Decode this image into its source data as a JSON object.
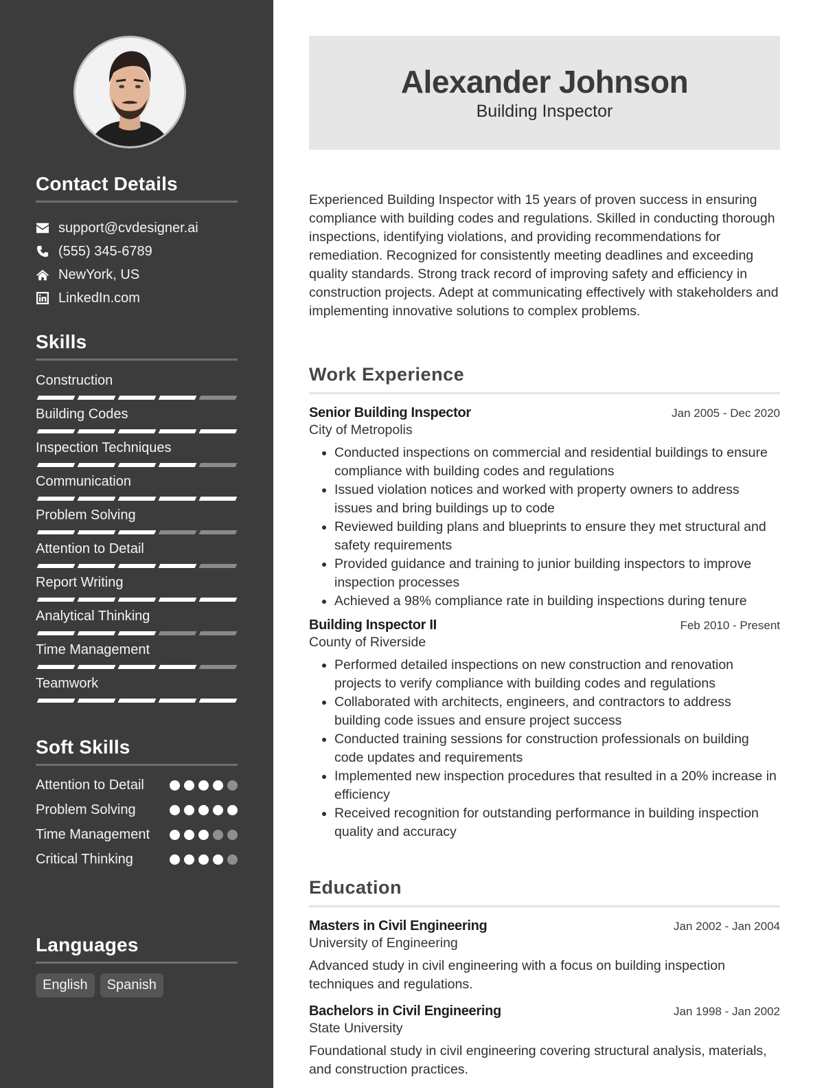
{
  "profile": {
    "name": "Alexander Johnson",
    "title": "Building Inspector",
    "photo_alt": "profile-photo"
  },
  "sidebar": {
    "contact": {
      "heading": "Contact Details",
      "items": [
        {
          "icon": "envelope-icon",
          "text": "support@cvdesigner.ai"
        },
        {
          "icon": "phone-icon",
          "text": "(555) 345-6789"
        },
        {
          "icon": "home-icon",
          "text": "NewYork, US"
        },
        {
          "icon": "linkedin-icon",
          "text": "LinkedIn.com"
        }
      ]
    },
    "skills": {
      "heading": "Skills",
      "max_level": 5,
      "items": [
        {
          "name": "Construction",
          "level": 4
        },
        {
          "name": "Building Codes",
          "level": 5
        },
        {
          "name": "Inspection Techniques",
          "level": 4
        },
        {
          "name": "Communication",
          "level": 5
        },
        {
          "name": "Problem Solving",
          "level": 3
        },
        {
          "name": "Attention to Detail",
          "level": 4
        },
        {
          "name": "Report Writing",
          "level": 5
        },
        {
          "name": "Analytical Thinking",
          "level": 3
        },
        {
          "name": "Time Management",
          "level": 4
        },
        {
          "name": "Teamwork",
          "level": 5
        }
      ]
    },
    "soft_skills": {
      "heading": "Soft Skills",
      "max_level": 5,
      "items": [
        {
          "name": "Attention to Detail",
          "level": 4
        },
        {
          "name": "Problem Solving",
          "level": 5
        },
        {
          "name": "Time Management",
          "level": 3
        },
        {
          "name": "Critical Thinking",
          "level": 4
        }
      ]
    },
    "languages": {
      "heading": "Languages",
      "items": [
        "English",
        "Spanish"
      ]
    }
  },
  "summary": "Experienced Building Inspector with 15 years of proven success in ensuring compliance with building codes and regulations. Skilled in conducting thorough inspections, identifying violations, and providing recommendations for remediation. Recognized for consistently meeting deadlines and exceeding quality standards. Strong track record of improving safety and efficiency in construction projects. Adept at communicating effectively with stakeholders and implementing innovative solutions to complex problems.",
  "work": {
    "heading": "Work Experience",
    "entries": [
      {
        "title": "Senior Building Inspector",
        "org": "City of Metropolis",
        "date": "Jan 2005 - Dec 2020",
        "bullets": [
          "Conducted inspections on commercial and residential buildings to ensure compliance with building codes and regulations",
          "Issued violation notices and worked with property owners to address issues and bring buildings up to code",
          "Reviewed building plans and blueprints to ensure they met structural and safety requirements",
          "Provided guidance and training to junior building inspectors to improve inspection processes",
          "Achieved a 98% compliance rate in building inspections during tenure"
        ]
      },
      {
        "title": "Building Inspector II",
        "org": "County of Riverside",
        "date": "Feb 2010 - Present",
        "bullets": [
          "Performed detailed inspections on new construction and renovation projects to verify compliance with building codes and regulations",
          "Collaborated with architects, engineers, and contractors to address building code issues and ensure project success",
          "Conducted training sessions for construction professionals on building code updates and requirements",
          "Implemented new inspection procedures that resulted in a 20% increase in efficiency",
          "Received recognition for outstanding performance in building inspection quality and accuracy"
        ]
      }
    ]
  },
  "education": {
    "heading": "Education",
    "entries": [
      {
        "title": "Masters in Civil Engineering",
        "org": "University of Engineering",
        "date": "Jan 2002 - Jan 2004",
        "description": "Advanced study in civil engineering with a focus on building inspection techniques and regulations."
      },
      {
        "title": "Bachelors in Civil Engineering",
        "org": "State University",
        "date": "Jan 1998 - Jan 2002",
        "description": "Foundational study in civil engineering covering structural analysis, materials, and construction practices."
      }
    ]
  },
  "colors": {
    "sidebar_bg": "#3c3c3c",
    "header_bg": "#e6e6e6",
    "level_on": "#ffffff",
    "level_off": "#8a8a8a"
  }
}
